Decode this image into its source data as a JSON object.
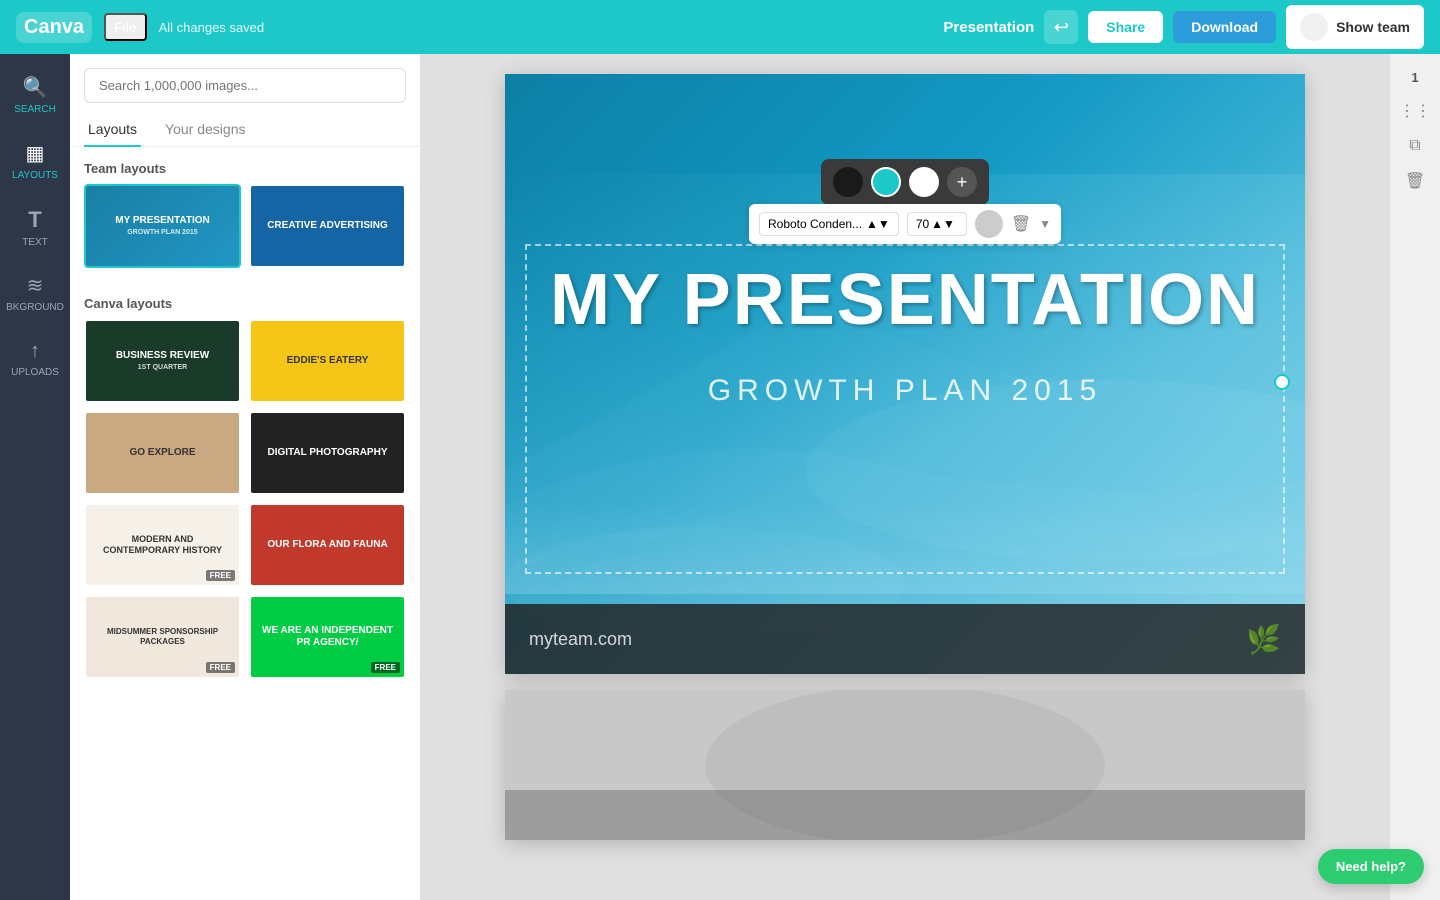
{
  "topbar": {
    "logo_text": "Canva",
    "file_label": "File",
    "saved_status": "All changes saved",
    "presentation_label": "Presentation",
    "share_label": "Share",
    "download_label": "Download",
    "show_team_label": "Show team"
  },
  "sidebar": {
    "items": [
      {
        "id": "search",
        "label": "SEARCH",
        "icon": "🔍"
      },
      {
        "id": "layouts",
        "label": "LAYOUTS",
        "icon": "▦"
      },
      {
        "id": "text",
        "label": "TEXT",
        "icon": "T"
      },
      {
        "id": "bkground",
        "label": "BKGROUND",
        "icon": "≋"
      },
      {
        "id": "uploads",
        "label": "UPLOADS",
        "icon": "↑"
      }
    ]
  },
  "panel": {
    "search_placeholder": "Search 1,000,000 images...",
    "tabs": [
      "Layouts",
      "Your designs"
    ],
    "active_tab": "Layouts",
    "sections": [
      {
        "title": "Team layouts",
        "layouts": [
          {
            "label": "MY PRESENTATION",
            "sublabel": "GROWTH PLAN 2015",
            "style": "my-presentation"
          },
          {
            "label": "CREATIVE ADVERTISING",
            "sublabel": "",
            "style": "creative-adv"
          }
        ]
      },
      {
        "title": "Canva layouts",
        "layouts": [
          {
            "label": "BUSINESS REVIEW",
            "sublabel": "1ST QUARTER",
            "style": "business-review"
          },
          {
            "label": "EDDIE'S EATERY",
            "sublabel": "",
            "style": "eddies"
          },
          {
            "label": "GO EXPLORE",
            "sublabel": "",
            "style": "go-explore"
          },
          {
            "label": "DIGITAL PHOTOGRAPHY",
            "sublabel": "",
            "style": "digital-photo"
          },
          {
            "label": "MODERN AND CONTEMPORARY HISTORY",
            "sublabel": "",
            "style": "modern-history",
            "free": true
          },
          {
            "label": "OUR FLORA AND FAUNA",
            "sublabel": "",
            "style": "flora-fauna"
          },
          {
            "label": "MIDSUMMER SPONSORSHIP PACKAGES",
            "sublabel": "",
            "style": "midsummer",
            "free": true
          },
          {
            "label": "WE ARE AN INDEPENDENT PR AGENCY/",
            "sublabel": "",
            "style": "pr-agency",
            "free": true
          }
        ]
      }
    ]
  },
  "slide1": {
    "main_title": "MY PRESENTATION",
    "subtitle": "GROWTH PLAN 2015",
    "bottom_url": "myteam.com",
    "font_name": "Roboto Conden...",
    "font_size": "70"
  },
  "color_palette": {
    "colors": [
      "#1a1a1a",
      "#1dc8c8",
      "#ffffff"
    ],
    "add_label": "+"
  },
  "right_panel": {
    "slide_number": "1"
  },
  "need_help": "Need help?"
}
